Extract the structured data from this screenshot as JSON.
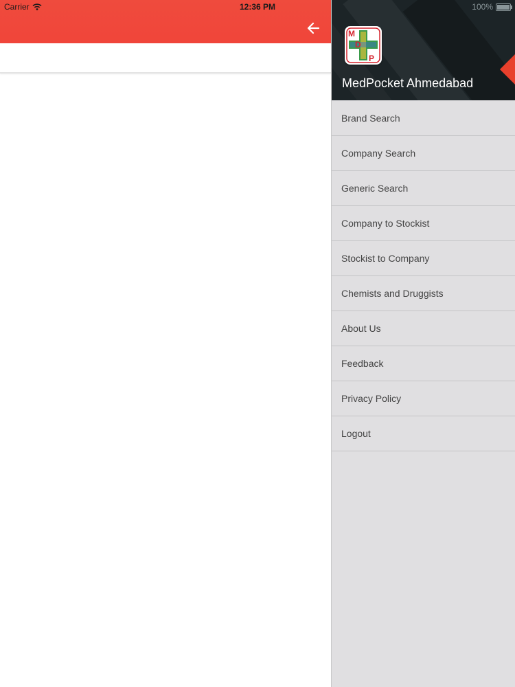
{
  "status_bar": {
    "carrier": "Carrier",
    "time": "12:36 PM",
    "battery": "100%"
  },
  "app_bar": {
    "color": "#f0453a",
    "back_icon": "arrow-left-icon"
  },
  "drawer": {
    "app_name": "MedPocket Ahmedabad",
    "logo_letters": [
      "M",
      "D",
      "P"
    ],
    "items": [
      {
        "label": "Brand Search"
      },
      {
        "label": "Company Search"
      },
      {
        "label": "Generic Search"
      },
      {
        "label": "Company to Stockist"
      },
      {
        "label": "Stockist to Company"
      },
      {
        "label": "Chemists and Druggists"
      },
      {
        "label": "About Us"
      },
      {
        "label": "Feedback"
      },
      {
        "label": "Privacy Policy"
      },
      {
        "label": "Logout"
      }
    ]
  }
}
